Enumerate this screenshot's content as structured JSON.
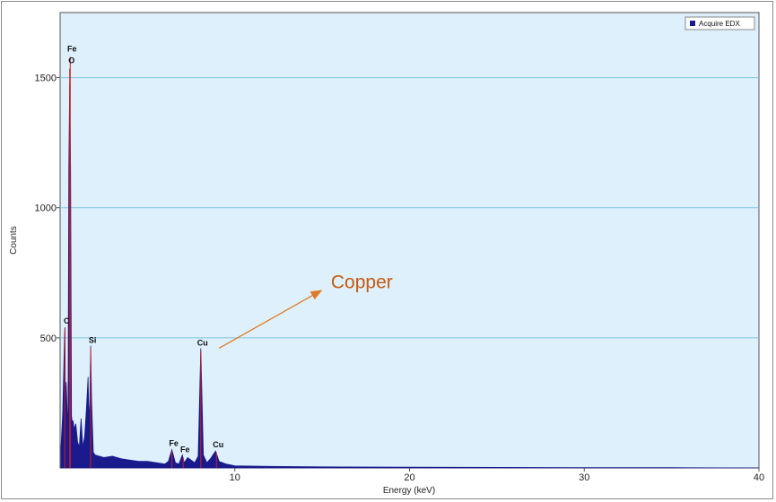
{
  "chart_data": {
    "type": "area",
    "xlabel": "Energy (keV)",
    "ylabel": "Counts",
    "xlim": [
      0,
      40
    ],
    "ylim": [
      0,
      1750
    ],
    "x_ticks": [
      10,
      20,
      30,
      40
    ],
    "y_ticks": [
      500,
      1000,
      1500
    ],
    "grid": "horizontal",
    "legend": {
      "placement": "top-right",
      "entries": [
        "Acquire EDX"
      ]
    },
    "colors": {
      "plot_bg": "#ddf0fb",
      "fill": "#1a1a8c",
      "marker": "#cc1f1f",
      "grid": "#7fc4e6",
      "annotation": "#e07b2a"
    },
    "series": [
      {
        "name": "Acquire EDX",
        "x": [
          0.05,
          0.15,
          0.25,
          0.28,
          0.3,
          0.35,
          0.45,
          0.5,
          0.55,
          0.6,
          0.65,
          0.7,
          0.72,
          0.75,
          0.8,
          0.85,
          0.9,
          1.0,
          1.1,
          1.2,
          1.3,
          1.4,
          1.5,
          1.6,
          1.65,
          1.7,
          1.75,
          1.8,
          1.9,
          2.0,
          2.5,
          3.0,
          3.5,
          4.0,
          4.5,
          5.0,
          5.5,
          6.0,
          6.2,
          6.4,
          6.6,
          6.8,
          7.0,
          7.1,
          7.3,
          7.5,
          7.7,
          7.9,
          8.05,
          8.2,
          8.4,
          8.6,
          8.9,
          9.1,
          9.5,
          10.0,
          12.0,
          15.0,
          20.0,
          25.0,
          30.0,
          35.0,
          40.0
        ],
        "y": [
          80,
          210,
          500,
          540,
          260,
          330,
          130,
          1150,
          1480,
          1150,
          200,
          170,
          180,
          180,
          150,
          160,
          170,
          100,
          80,
          190,
          80,
          120,
          220,
          350,
          180,
          250,
          470,
          260,
          60,
          50,
          40,
          45,
          35,
          30,
          25,
          25,
          20,
          15,
          25,
          70,
          20,
          15,
          50,
          20,
          40,
          30,
          20,
          45,
          460,
          50,
          20,
          35,
          65,
          25,
          15,
          8,
          6,
          4,
          3,
          2,
          1,
          1,
          0
        ]
      }
    ],
    "peak_labels": [
      {
        "text": "Fe",
        "x": 0.58,
        "y": 1600
      },
      {
        "text": "O",
        "x": 0.55,
        "y": 1555
      },
      {
        "text": "C",
        "x": 0.27,
        "y": 555
      },
      {
        "text": "Si",
        "x": 1.75,
        "y": 480
      },
      {
        "text": "Cu",
        "x": 8.05,
        "y": 470
      },
      {
        "text": "Fe",
        "x": 6.4,
        "y": 85
      },
      {
        "text": "Fe",
        "x": 7.05,
        "y": 60
      },
      {
        "text": "Cu",
        "x": 8.95,
        "y": 80
      }
    ],
    "annotation": {
      "text": "Copper",
      "arrow_from": [
        9.1,
        460
      ],
      "arrow_to": [
        14.9,
        680
      ],
      "text_at": [
        15.5,
        690
      ]
    }
  }
}
